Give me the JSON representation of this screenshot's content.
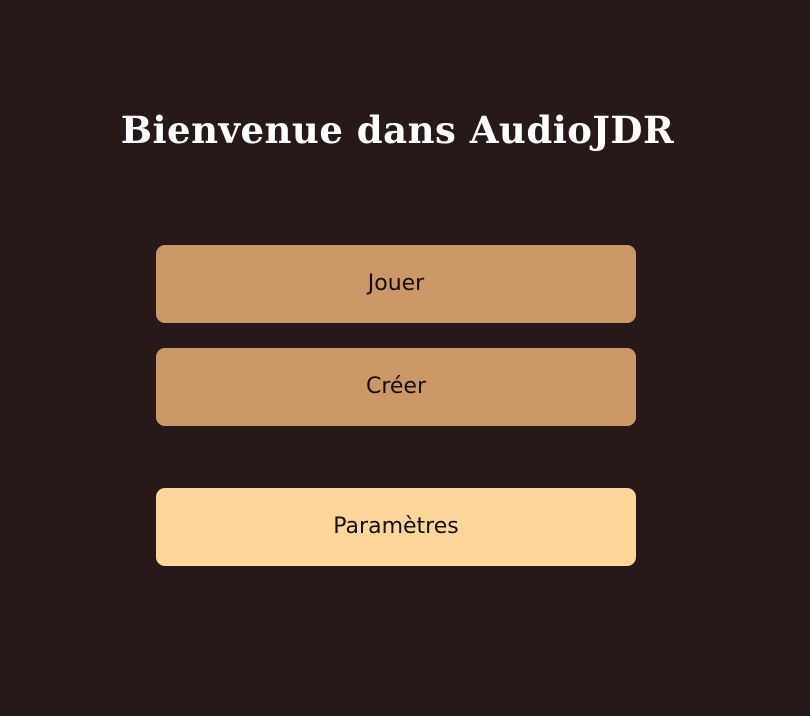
{
  "title": "Bienvenue dans AudioJDR",
  "menu": {
    "play_label": "Jouer",
    "create_label": "Créer",
    "settings_label": "Paramètres"
  },
  "colors": {
    "background": "#261917",
    "primary_button": "#cd9868",
    "secondary_button": "#ffd699",
    "title_text": "#ffffff"
  }
}
